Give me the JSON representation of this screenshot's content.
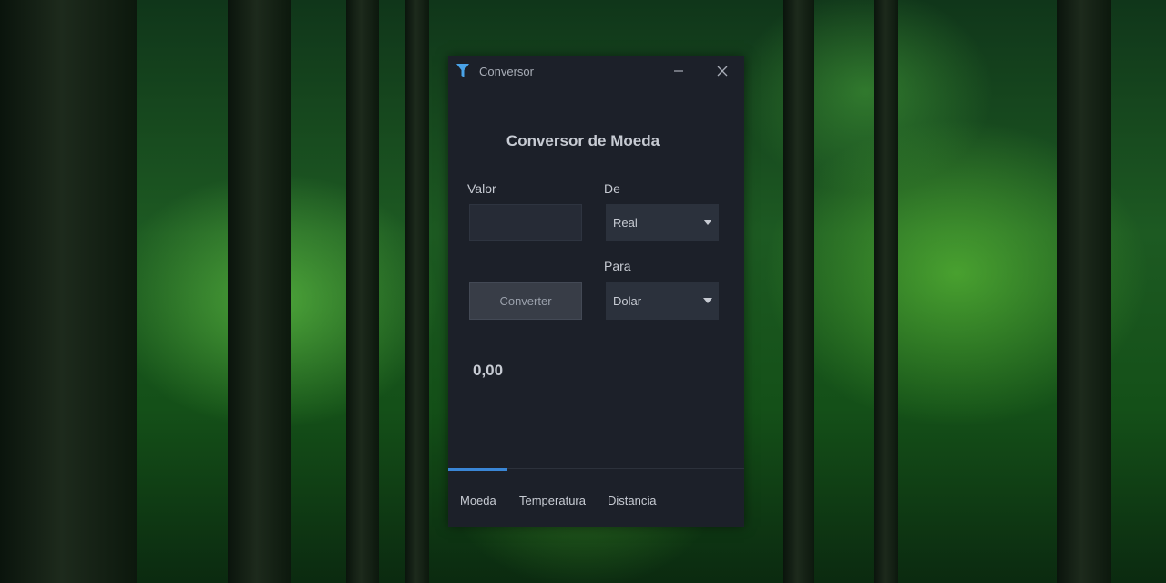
{
  "window": {
    "title": "Conversor",
    "icon": "filter-funnel-icon",
    "accent_color": "#3a86d6",
    "background_color": "#1c2029"
  },
  "converter": {
    "heading": "Conversor de Moeda",
    "value_label": "Valor",
    "value_input": "",
    "from_label": "De",
    "from_selected": "Real",
    "to_label": "Para",
    "to_selected": "Dolar",
    "convert_button": "Converter",
    "result": "0,00"
  },
  "tabs": [
    {
      "label": "Moeda",
      "active": true
    },
    {
      "label": "Temperatura",
      "active": false
    },
    {
      "label": "Distancia",
      "active": false
    }
  ]
}
